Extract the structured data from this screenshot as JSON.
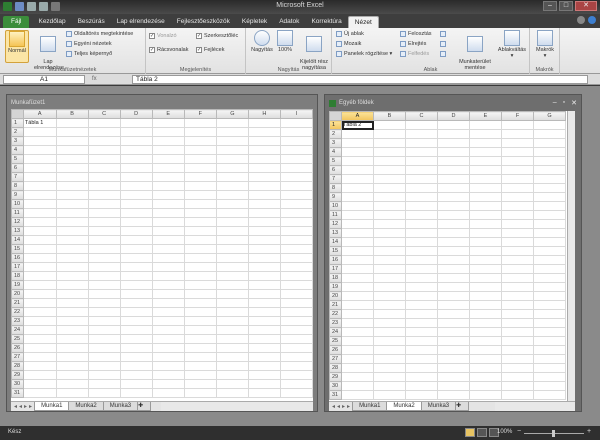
{
  "window": {
    "title": "Microsoft Excel"
  },
  "tabs": [
    "Fájl",
    "Kezdőlap",
    "Beszúrás",
    "Lap elrendezése",
    "Fejlesztőeszközök",
    "Képletek",
    "Adatok",
    "Korrektúra",
    "Nézet"
  ],
  "ribbon": {
    "g1": {
      "label": "Munkafüzetnézetek",
      "normal": "Normál",
      "layout": "Lap\nelrendezése",
      "pagebreak": "Oldaltörés megtekintése",
      "custom": "Egyéni nézetek",
      "full": "Teljes képernyő"
    },
    "g2": {
      "label": "Megjelenítés",
      "ruler": "Vonalzó",
      "formulabar": "Szerkesztőléc",
      "gridlines": "Rácsvonalak",
      "headings": "Fejlécek"
    },
    "g3": {
      "label": "Nagyítás",
      "zoom": "Nagyítás",
      "hundred": "100%",
      "selection": "Kijelölt rész\nnagyítása"
    },
    "g4": {
      "label": "Ablak",
      "newwin": "Új ablak",
      "arrange": "Mozaik",
      "freeze": "Panelek rögzítése",
      "split": "Felosztás",
      "hide": "Elrejtés",
      "unhide": "Felfedés",
      "save": "Munkaterület\nmentése",
      "switch": "Ablakváltás"
    },
    "g5": {
      "label": "Makrók",
      "macros": "Makrók"
    }
  },
  "formula": {
    "namebox": "A1",
    "fx": "fx",
    "value": "Tábla 2"
  },
  "win1": {
    "title": "Munkafüzet1",
    "a1": "Tábla 1",
    "columns": [
      "A",
      "B",
      "C",
      "D",
      "E",
      "F",
      "G",
      "H",
      "I"
    ],
    "sheets": [
      "Munka1",
      "Munka2",
      "Munka3"
    ]
  },
  "win2": {
    "title": "Egyéb földek",
    "a1": "Tábla 2",
    "columns": [
      "A",
      "B",
      "C",
      "D",
      "E",
      "F",
      "G"
    ],
    "sheets": [
      "Munka1",
      "Munka2",
      "Munka3"
    ]
  },
  "status": {
    "ready": "Kész",
    "zoom": "100%"
  },
  "colors": {
    "file_tab": "#3b8d3b",
    "active_cell_header": "#f2c55c"
  }
}
